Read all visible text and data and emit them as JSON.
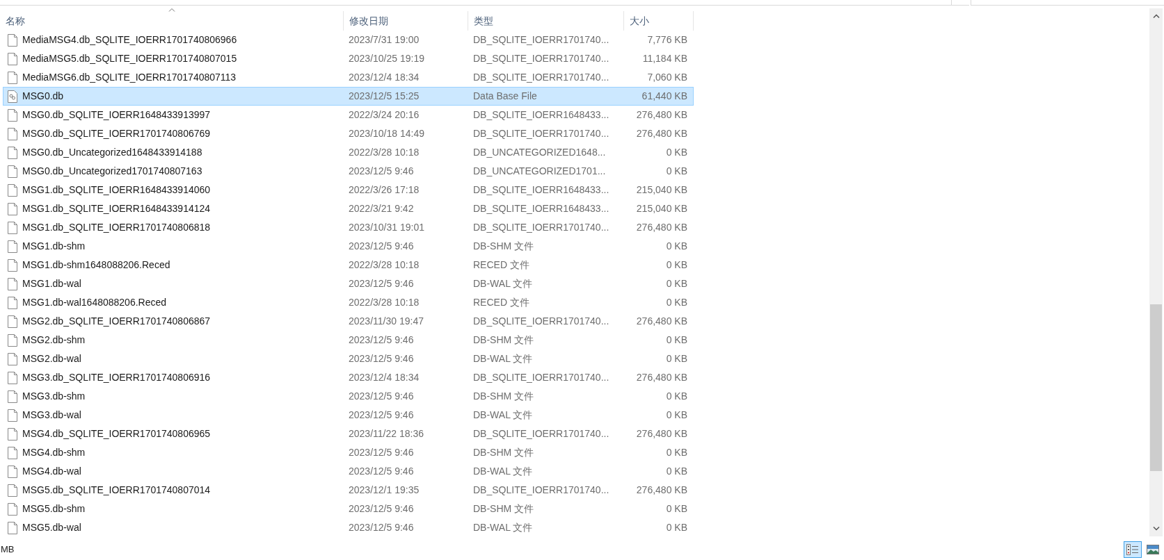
{
  "columns": [
    {
      "label": "名称",
      "sorted": true
    },
    {
      "label": "修改日期",
      "sorted": false
    },
    {
      "label": "类型",
      "sorted": false
    },
    {
      "label": "大小",
      "sorted": false
    }
  ],
  "rows": [
    {
      "kind": "file",
      "name": "MediaMSG4.db_SQLITE_IOERR1701740806966",
      "date": "2023/7/31 19:00",
      "type": "DB_SQLITE_IOERR1701740...",
      "size": "7,776 KB",
      "selected": false
    },
    {
      "kind": "file",
      "name": "MediaMSG5.db_SQLITE_IOERR1701740807015",
      "date": "2023/10/25 19:19",
      "type": "DB_SQLITE_IOERR1701740...",
      "size": "11,184 KB",
      "selected": false
    },
    {
      "kind": "file",
      "name": "MediaMSG6.db_SQLITE_IOERR1701740807113",
      "date": "2023/12/4 18:34",
      "type": "DB_SQLITE_IOERR1701740...",
      "size": "7,060 KB",
      "selected": false
    },
    {
      "kind": "database",
      "name": "MSG0.db",
      "date": "2023/12/5 15:25",
      "type": "Data Base File",
      "size": "61,440 KB",
      "selected": true
    },
    {
      "kind": "file",
      "name": "MSG0.db_SQLITE_IOERR1648433913997",
      "date": "2022/3/24 20:16",
      "type": "DB_SQLITE_IOERR1648433...",
      "size": "276,480 KB",
      "selected": false
    },
    {
      "kind": "file",
      "name": "MSG0.db_SQLITE_IOERR1701740806769",
      "date": "2023/10/18 14:49",
      "type": "DB_SQLITE_IOERR1701740...",
      "size": "276,480 KB",
      "selected": false
    },
    {
      "kind": "file",
      "name": "MSG0.db_Uncategorized1648433914188",
      "date": "2022/3/28 10:18",
      "type": "DB_UNCATEGORIZED1648...",
      "size": "0 KB",
      "selected": false
    },
    {
      "kind": "file",
      "name": "MSG0.db_Uncategorized1701740807163",
      "date": "2023/12/5 9:46",
      "type": "DB_UNCATEGORIZED1701...",
      "size": "0 KB",
      "selected": false
    },
    {
      "kind": "file",
      "name": "MSG1.db_SQLITE_IOERR1648433914060",
      "date": "2022/3/26 17:18",
      "type": "DB_SQLITE_IOERR1648433...",
      "size": "215,040 KB",
      "selected": false
    },
    {
      "kind": "file",
      "name": "MSG1.db_SQLITE_IOERR1648433914124",
      "date": "2022/3/21 9:42",
      "type": "DB_SQLITE_IOERR1648433...",
      "size": "215,040 KB",
      "selected": false
    },
    {
      "kind": "file",
      "name": "MSG1.db_SQLITE_IOERR1701740806818",
      "date": "2023/10/31 19:01",
      "type": "DB_SQLITE_IOERR1701740...",
      "size": "276,480 KB",
      "selected": false
    },
    {
      "kind": "file",
      "name": "MSG1.db-shm",
      "date": "2023/12/5 9:46",
      "type": "DB-SHM 文件",
      "size": "0 KB",
      "selected": false
    },
    {
      "kind": "file",
      "name": "MSG1.db-shm1648088206.Reced",
      "date": "2022/3/28 10:18",
      "type": "RECED 文件",
      "size": "0 KB",
      "selected": false
    },
    {
      "kind": "file",
      "name": "MSG1.db-wal",
      "date": "2023/12/5 9:46",
      "type": "DB-WAL 文件",
      "size": "0 KB",
      "selected": false
    },
    {
      "kind": "file",
      "name": "MSG1.db-wal1648088206.Reced",
      "date": "2022/3/28 10:18",
      "type": "RECED 文件",
      "size": "0 KB",
      "selected": false
    },
    {
      "kind": "file",
      "name": "MSG2.db_SQLITE_IOERR1701740806867",
      "date": "2023/11/30 19:47",
      "type": "DB_SQLITE_IOERR1701740...",
      "size": "276,480 KB",
      "selected": false
    },
    {
      "kind": "file",
      "name": "MSG2.db-shm",
      "date": "2023/12/5 9:46",
      "type": "DB-SHM 文件",
      "size": "0 KB",
      "selected": false
    },
    {
      "kind": "file",
      "name": "MSG2.db-wal",
      "date": "2023/12/5 9:46",
      "type": "DB-WAL 文件",
      "size": "0 KB",
      "selected": false
    },
    {
      "kind": "file",
      "name": "MSG3.db_SQLITE_IOERR1701740806916",
      "date": "2023/12/4 18:34",
      "type": "DB_SQLITE_IOERR1701740...",
      "size": "276,480 KB",
      "selected": false
    },
    {
      "kind": "file",
      "name": "MSG3.db-shm",
      "date": "2023/12/5 9:46",
      "type": "DB-SHM 文件",
      "size": "0 KB",
      "selected": false
    },
    {
      "kind": "file",
      "name": "MSG3.db-wal",
      "date": "2023/12/5 9:46",
      "type": "DB-WAL 文件",
      "size": "0 KB",
      "selected": false
    },
    {
      "kind": "file",
      "name": "MSG4.db_SQLITE_IOERR1701740806965",
      "date": "2023/11/22 18:36",
      "type": "DB_SQLITE_IOERR1701740...",
      "size": "276,480 KB",
      "selected": false
    },
    {
      "kind": "file",
      "name": "MSG4.db-shm",
      "date": "2023/12/5 9:46",
      "type": "DB-SHM 文件",
      "size": "0 KB",
      "selected": false
    },
    {
      "kind": "file",
      "name": "MSG4.db-wal",
      "date": "2023/12/5 9:46",
      "type": "DB-WAL 文件",
      "size": "0 KB",
      "selected": false
    },
    {
      "kind": "file",
      "name": "MSG5.db_SQLITE_IOERR1701740807014",
      "date": "2023/12/1 19:35",
      "type": "DB_SQLITE_IOERR1701740...",
      "size": "276,480 KB",
      "selected": false
    },
    {
      "kind": "file",
      "name": "MSG5.db-shm",
      "date": "2023/12/5 9:46",
      "type": "DB-SHM 文件",
      "size": "0 KB",
      "selected": false
    },
    {
      "kind": "file",
      "name": "MSG5.db-wal",
      "date": "2023/12/5 9:46",
      "type": "DB-WAL 文件",
      "size": "0 KB",
      "selected": false
    }
  ],
  "status_bar": {
    "text": "MB"
  },
  "view_buttons": [
    {
      "kind": "details",
      "selected": true
    },
    {
      "kind": "large-icons",
      "selected": false
    }
  ]
}
